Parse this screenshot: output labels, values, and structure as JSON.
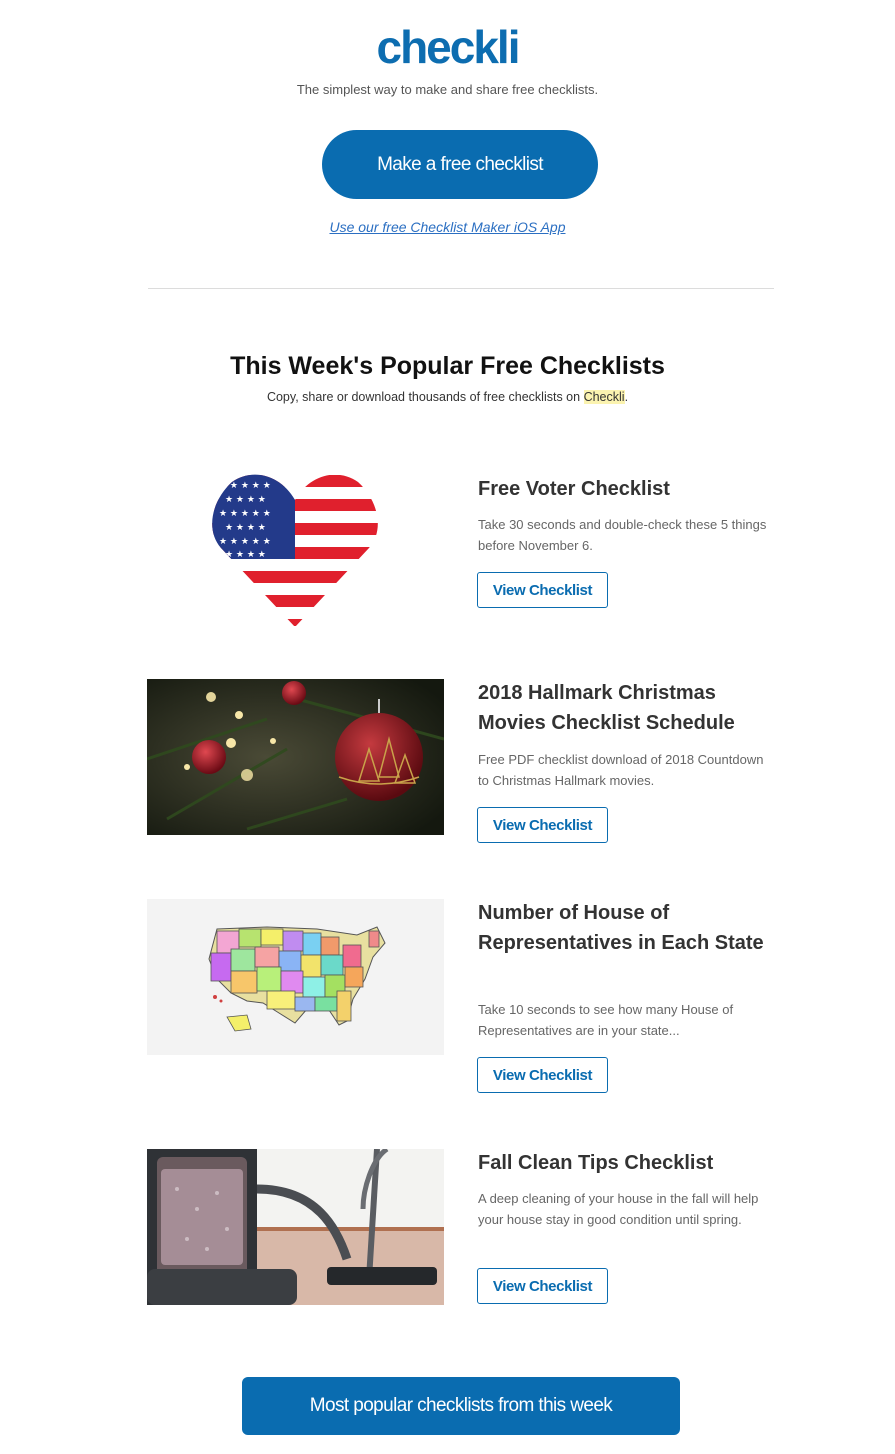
{
  "brand": {
    "logo_text": "checkli",
    "tagline": "The simplest way to make and share free checklists.",
    "cta_label": "Make a free checklist",
    "ios_link": "Use our free Checklist Maker iOS App",
    "accent_color": "#0a6cb0"
  },
  "section": {
    "title": "This Week's Popular Free Checklists",
    "subtitle_before": "Copy, share or download thousands of free checklists on ",
    "subtitle_highlight": "Checkli",
    "subtitle_after": "."
  },
  "items": [
    {
      "image_icon": "us-flag-heart-image",
      "title": "Free Voter Checklist",
      "description": "Take 30 seconds and double-check these 5 things before November 6.",
      "button": "View Checklist"
    },
    {
      "image_icon": "christmas-ornament-image",
      "title": "2018 Hallmark Christmas Movies Checklist Schedule",
      "description": "Free PDF checklist download of 2018 Countdown to Christmas Hallmark movies.",
      "button": "View Checklist"
    },
    {
      "image_icon": "us-states-map-image",
      "title": "Number of House of Representatives in Each State",
      "description": "Take 10 seconds to see how many House of Representatives are in your state...",
      "button": "View Checklist"
    },
    {
      "image_icon": "vacuum-cleaner-image",
      "title": "Fall Clean Tips Checklist",
      "description": "A deep cleaning of your house in the fall will help your house stay in good condition until spring.",
      "button": "View Checklist"
    }
  ],
  "footer": {
    "bottom_button": "Most popular checklists from this week"
  }
}
